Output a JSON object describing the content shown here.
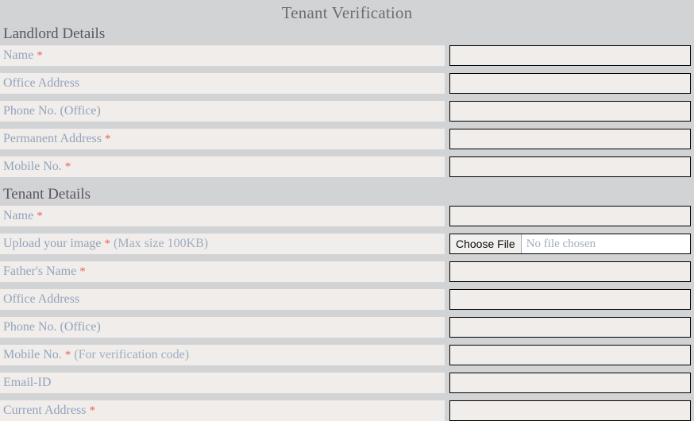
{
  "page": {
    "title": "Tenant Verification",
    "background_color": "#d2d3d5",
    "label_color": "#93a4bb",
    "required_marker_color": "#e8685f",
    "heading_color": "#57585c",
    "input_background": "#f0edeb",
    "row_background": "#f0edeb"
  },
  "sections": [
    {
      "heading": "Landlord Details",
      "rows": [
        {
          "label": "Name",
          "required": "*",
          "hint": "",
          "type": "text",
          "value": "",
          "placeholder": ""
        },
        {
          "label": "Office Address",
          "required": "",
          "hint": "",
          "type": "text",
          "value": "",
          "placeholder": ""
        },
        {
          "label": "Phone No. (Office)",
          "required": "",
          "hint": "",
          "type": "text",
          "value": "",
          "placeholder": ""
        },
        {
          "label": "Permanent Address",
          "required": "*",
          "hint": "",
          "type": "text",
          "value": "",
          "placeholder": ""
        },
        {
          "label": "Mobile No.",
          "required": "*",
          "hint": "",
          "type": "text",
          "value": "",
          "placeholder": ""
        }
      ]
    },
    {
      "heading": "Tenant Details",
      "rows": [
        {
          "label": "Name",
          "required": "*",
          "hint": "",
          "type": "text",
          "value": "",
          "placeholder": ""
        },
        {
          "label": "Upload your image",
          "required": "*",
          "hint": "(Max size 100KB)",
          "type": "file",
          "button_label": "Choose File",
          "file_status": "No file chosen"
        },
        {
          "label": "Father's Name",
          "required": "*",
          "hint": "",
          "type": "text",
          "value": "",
          "placeholder": ""
        },
        {
          "label": "Office Address",
          "required": "",
          "hint": "",
          "type": "text",
          "value": "",
          "placeholder": ""
        },
        {
          "label": "Phone No. (Office)",
          "required": "",
          "hint": "",
          "type": "text",
          "value": "",
          "placeholder": ""
        },
        {
          "label": "Mobile No.",
          "required": "*",
          "hint": "(For verification code)",
          "type": "text",
          "value": "",
          "placeholder": ""
        },
        {
          "label": "Email-ID",
          "required": "",
          "hint": "",
          "type": "text",
          "value": "",
          "placeholder": ""
        },
        {
          "label": "Current Address",
          "required": "*",
          "hint": "",
          "type": "text",
          "value": "",
          "placeholder": ""
        }
      ]
    }
  ]
}
